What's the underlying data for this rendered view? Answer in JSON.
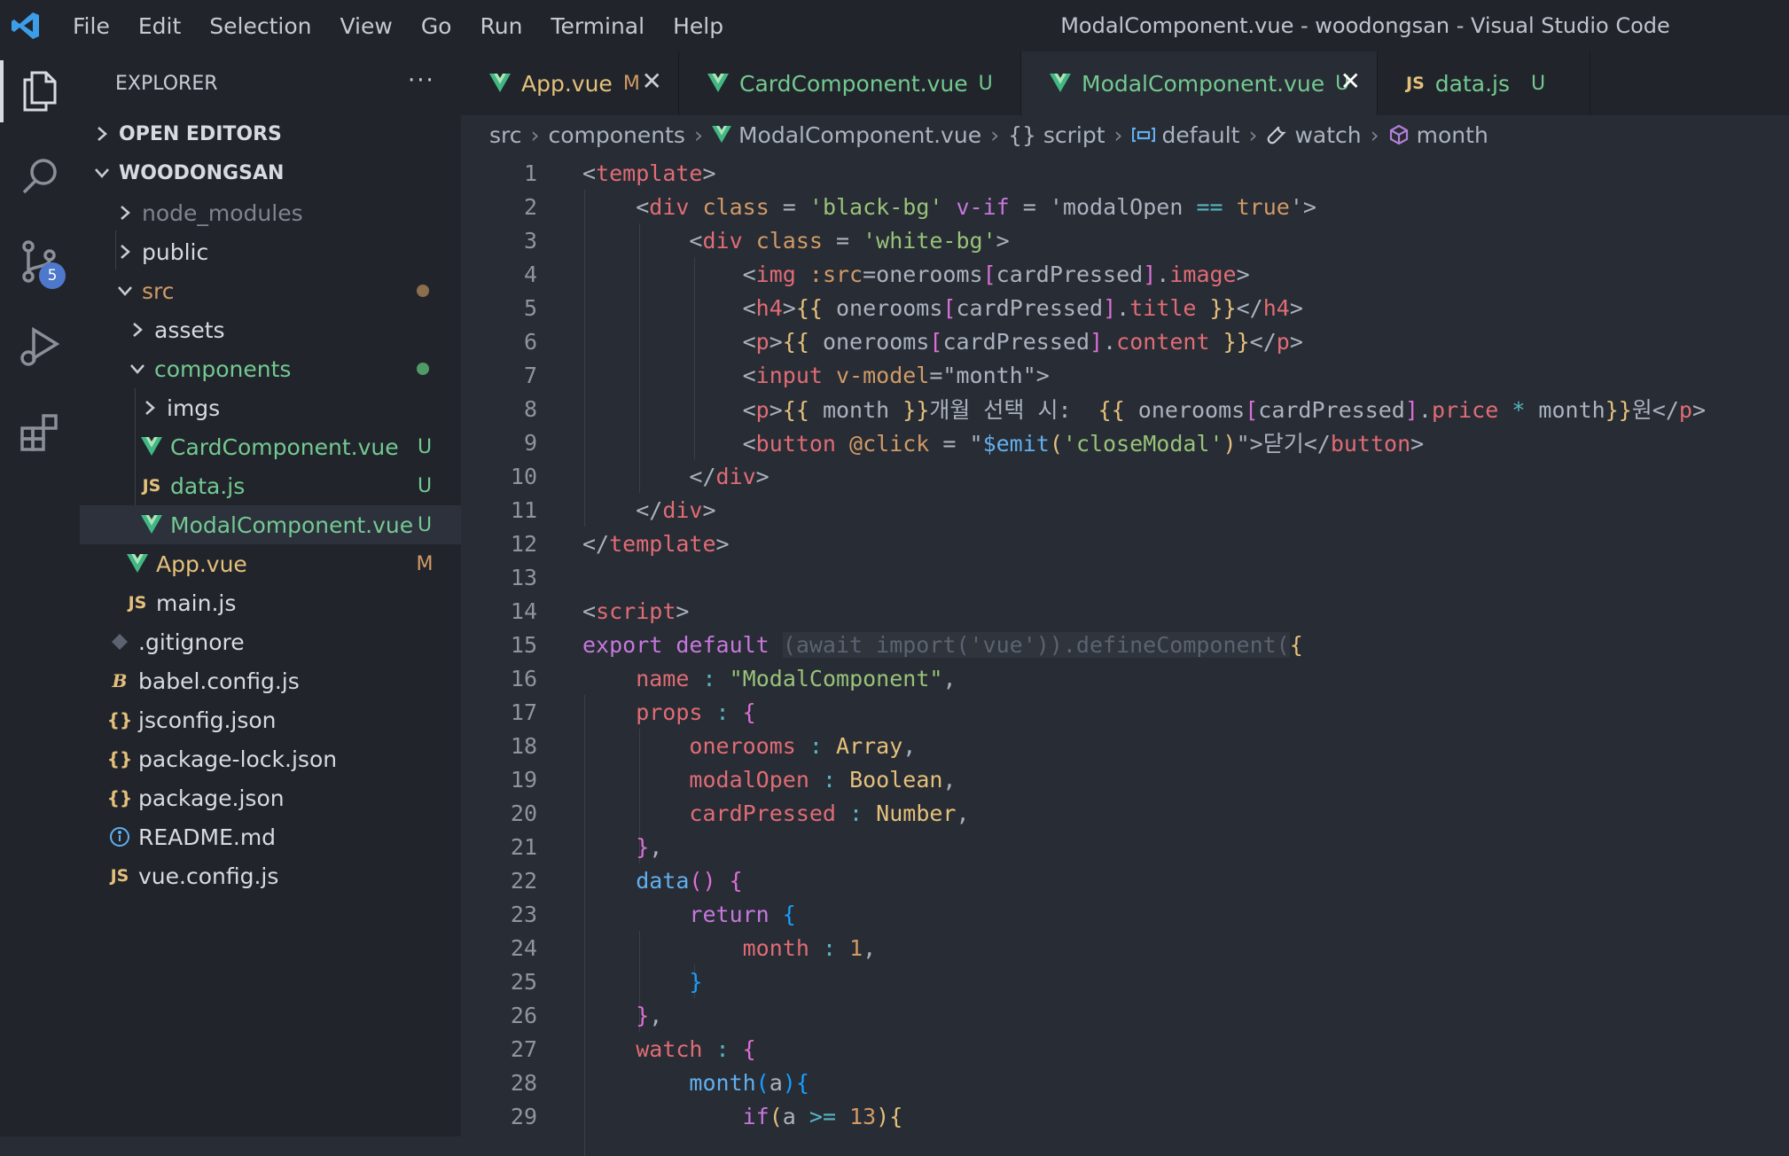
{
  "window": {
    "title": "ModalComponent.vue - woodongsan - Visual Studio Code"
  },
  "menu": [
    "File",
    "Edit",
    "Selection",
    "View",
    "Go",
    "Run",
    "Terminal",
    "Help"
  ],
  "activity": {
    "scm_badge": "5"
  },
  "explorer": {
    "title": "EXPLORER",
    "more": "···",
    "open_editors": "OPEN EDITORS",
    "project": "WOODONGSAN",
    "tree": [
      {
        "label": "node_modules",
        "status": ""
      },
      {
        "label": "public",
        "status": ""
      },
      {
        "label": "src",
        "status": ""
      },
      {
        "label": "assets",
        "status": ""
      },
      {
        "label": "components",
        "status": ""
      },
      {
        "label": "imgs",
        "status": ""
      },
      {
        "label": "CardComponent.vue",
        "status": "U"
      },
      {
        "label": "data.js",
        "status": "U"
      },
      {
        "label": "ModalComponent.vue",
        "status": "U"
      },
      {
        "label": "App.vue",
        "status": "M"
      },
      {
        "label": "main.js",
        "status": ""
      },
      {
        "label": ".gitignore",
        "status": ""
      },
      {
        "label": "babel.config.js",
        "status": ""
      },
      {
        "label": "jsconfig.json",
        "status": ""
      },
      {
        "label": "package-lock.json",
        "status": ""
      },
      {
        "label": "package.json",
        "status": ""
      },
      {
        "label": "README.md",
        "status": ""
      },
      {
        "label": "vue.config.js",
        "status": ""
      }
    ],
    "colors": {
      "modified": "#d19a66",
      "untracked": "#73c991",
      "ignored": "#7f848e"
    }
  },
  "tabs": [
    {
      "label": "App.vue",
      "status": "M"
    },
    {
      "label": "CardComponent.vue",
      "status": "U"
    },
    {
      "label": "ModalComponent.vue",
      "status": "U"
    },
    {
      "label": "data.js",
      "status": "U"
    }
  ],
  "breadcrumb": [
    "src",
    "components",
    "ModalComponent.vue",
    "{} script",
    "default",
    "watch",
    "month"
  ],
  "code": {
    "line_numbers": [
      "1",
      "2",
      "3",
      "4",
      "5",
      "6",
      "7",
      "8",
      "9",
      "10",
      "11",
      "12",
      "13",
      "14",
      "15",
      "16",
      "17",
      "18",
      "19",
      "20",
      "21",
      "22",
      "23",
      "24",
      "25",
      "26",
      "27",
      "28",
      "29"
    ]
  }
}
